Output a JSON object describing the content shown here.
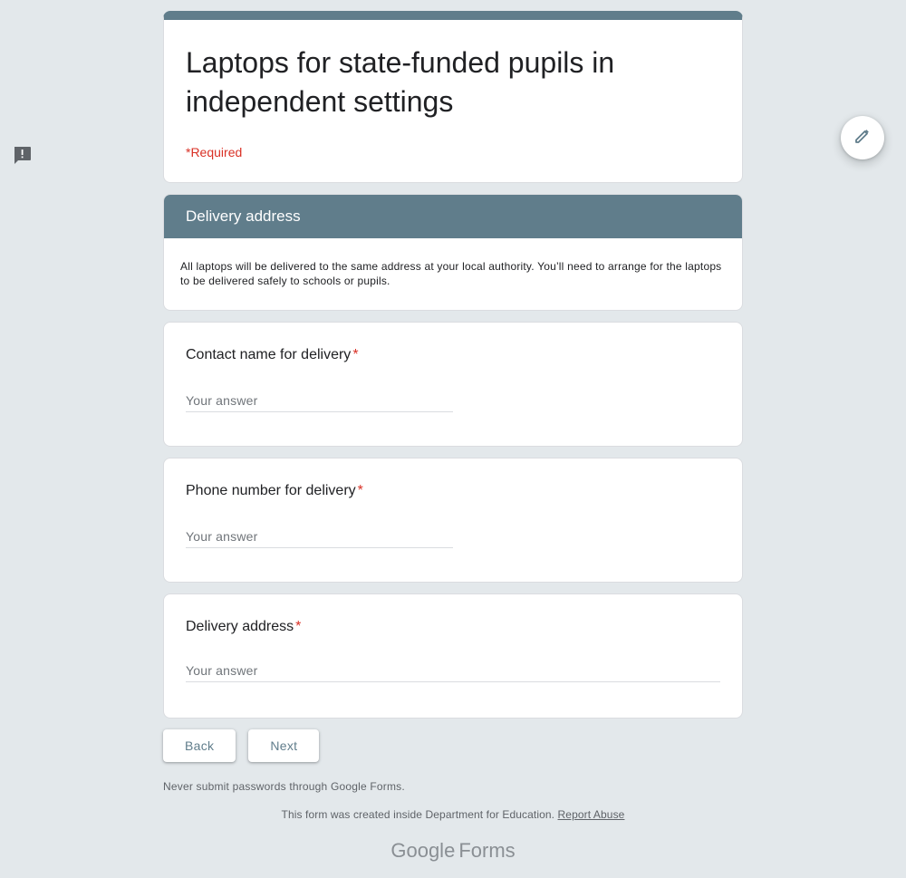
{
  "form": {
    "title": "Laptops for state-funded pupils in independent settings",
    "required_note": "*Required"
  },
  "section": {
    "title": "Delivery address",
    "description": "All laptops will be delivered to the same address at your local authority. You’ll need to arrange for the laptops to be delivered safely to schools or pupils."
  },
  "questions": [
    {
      "label": "Contact name for delivery",
      "placeholder": "Your answer"
    },
    {
      "label": "Phone number for delivery",
      "placeholder": "Your answer"
    },
    {
      "label": "Delivery address",
      "placeholder": "Your answer"
    }
  ],
  "required_mark": "*",
  "buttons": {
    "back": "Back",
    "next": "Next"
  },
  "warning": "Never submit passwords through Google Forms.",
  "footer": {
    "text": "This form was created inside Department for Education.",
    "report_link": "Report Abuse"
  },
  "brand": {
    "part1": "Google",
    "part2": "Forms"
  },
  "icons": {
    "edit": "pencil-icon",
    "feedback": "feedback-icon"
  },
  "colors": {
    "theme": "#607d8b",
    "required": "#d93025",
    "background": "#e3e8eb"
  }
}
